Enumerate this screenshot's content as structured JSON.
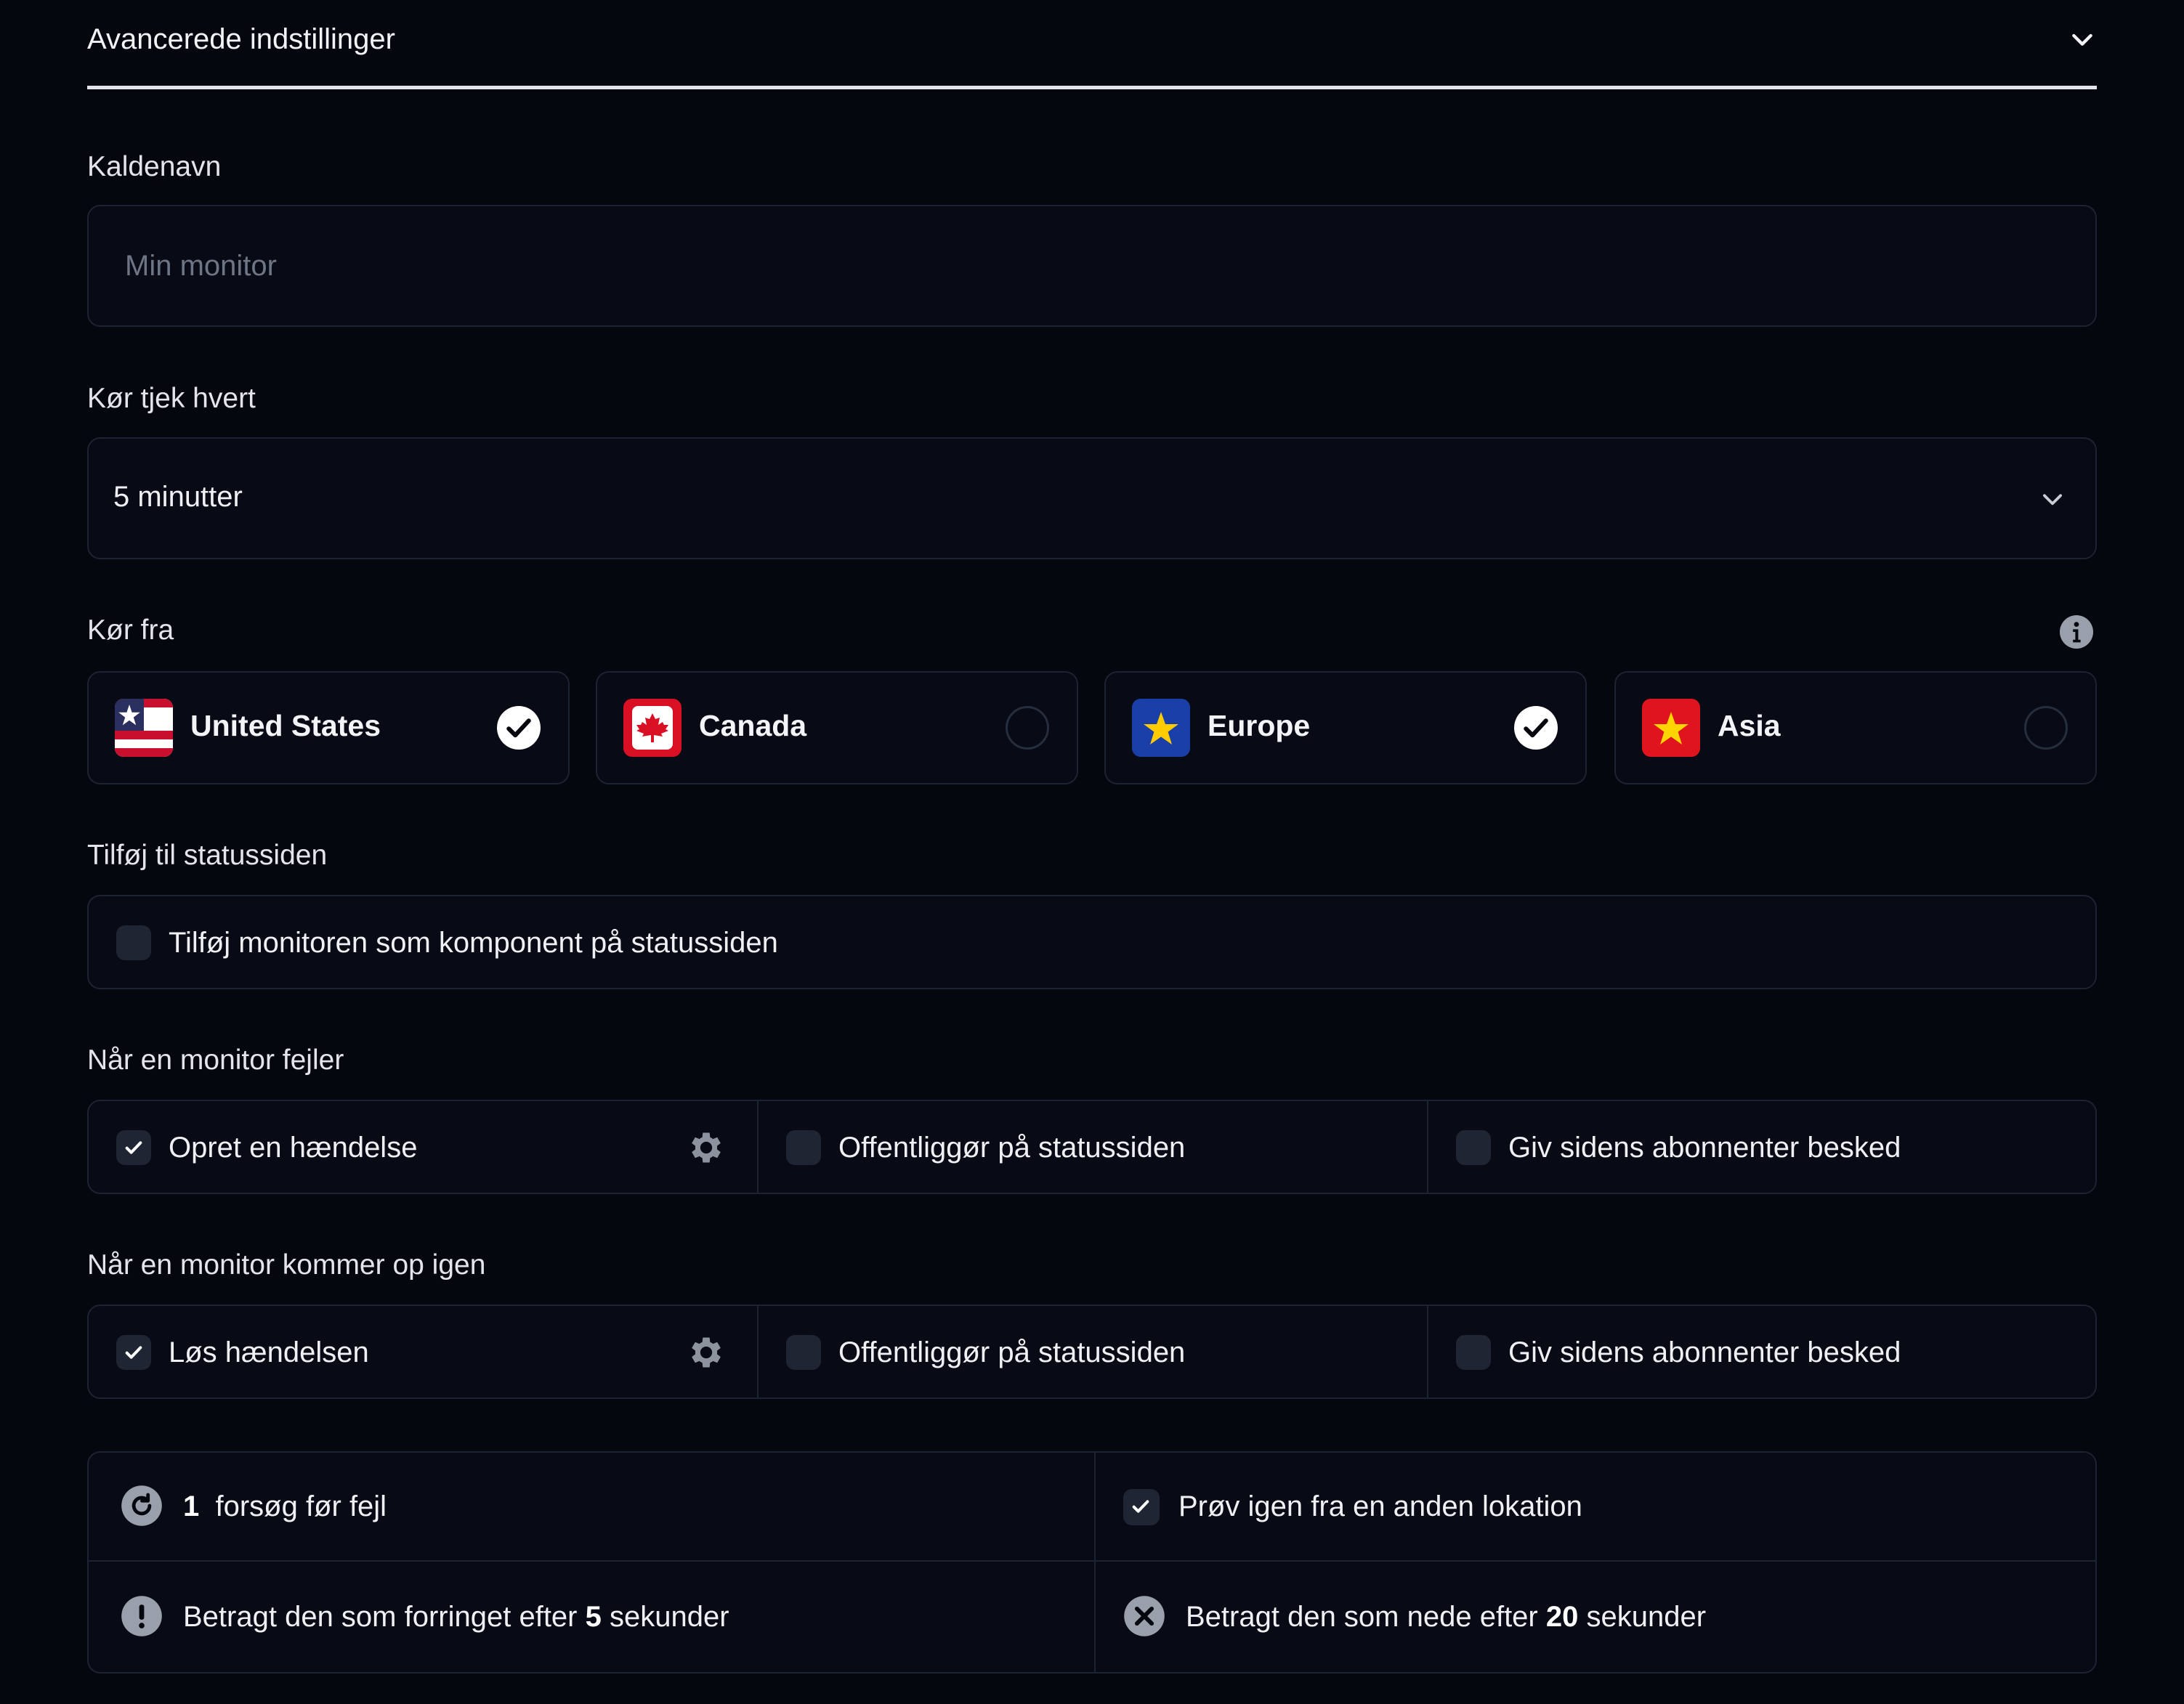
{
  "header": {
    "title": "Avancerede indstillinger"
  },
  "call_name": {
    "label": "Kaldenavn",
    "placeholder": "Min monitor",
    "value": ""
  },
  "interval": {
    "label": "Kør tjek hvert",
    "value": "5 minutter"
  },
  "run_from": {
    "label": "Kør fra",
    "regions": [
      {
        "name": "United States",
        "selected": true
      },
      {
        "name": "Canada",
        "selected": false
      },
      {
        "name": "Europe",
        "selected": true
      },
      {
        "name": "Asia",
        "selected": false
      }
    ]
  },
  "status_page": {
    "label": "Tilføj til statussiden",
    "option": "Tilføj monitoren som komponent på statussiden",
    "checked": false
  },
  "on_fail": {
    "label": "Når en monitor fejler",
    "options": [
      {
        "text": "Opret en hændelse",
        "checked": true
      },
      {
        "text": "Offentliggør på statussiden",
        "checked": false
      },
      {
        "text": "Giv sidens abonnenter besked",
        "checked": false
      }
    ]
  },
  "on_recover": {
    "label": "Når en monitor kommer op igen",
    "options": [
      {
        "text": "Løs hændelsen",
        "checked": true
      },
      {
        "text": "Offentliggør på statussiden",
        "checked": false
      },
      {
        "text": "Giv sidens abonnenter besked",
        "checked": false
      }
    ]
  },
  "settings": {
    "retries_count": "1",
    "retries_text": "forsøg før fejl",
    "retry_location": "Prøv igen fra en anden lokation",
    "retry_location_checked": true,
    "degraded_prefix": "Betragt den som forringet efter",
    "degraded_value": "5",
    "degraded_suffix": "sekunder",
    "down_prefix": "Betragt den som nede efter",
    "down_value": "20",
    "down_suffix": "sekunder"
  },
  "colors": {
    "background": "#05070f",
    "border": "#1c2333",
    "checkbox": "#1f2533",
    "text": "#eef0f4"
  }
}
